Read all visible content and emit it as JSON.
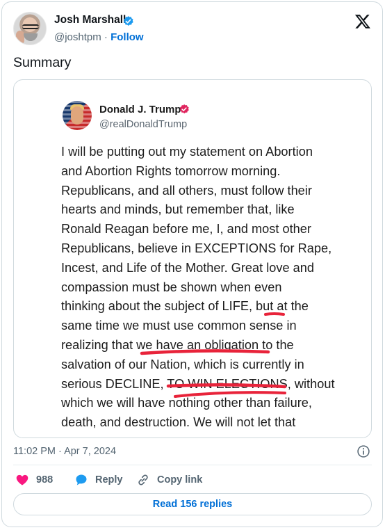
{
  "author": {
    "name": "Josh Marshall",
    "handle": "@joshtpm",
    "separator": "·",
    "follow_label": "Follow"
  },
  "tweet": {
    "text": "Summary",
    "timestamp": "11:02 PM · Apr 7, 2024"
  },
  "embedded_post": {
    "name": "Donald J. Trump",
    "handle": "@realDonaldTrump",
    "lines": [
      "I will be putting out my statement on Abortion",
      "and Abortion Rights tomorrow morning.",
      "Republicans, and all others, must follow their",
      "hearts and minds, but remember that, like",
      "Ronald Reagan before me, I, and most other",
      "Republicans, believe in EXCEPTIONS for Rape,",
      "Incest, and Life of the Mother. Great love and",
      "compassion must be shown when even",
      "thinking about the subject of LIFE, but at the",
      "same time we must use common sense in",
      "realizing that we have an obligation to the",
      "salvation of our Nation, which is currently in",
      "serious DECLINE, TO WIN ELECTIONS, without",
      "which we will have nothing other than failure,",
      "death, and destruction. We will not let that"
    ],
    "underline_color": "#e8233a"
  },
  "actions": {
    "like_count": "988",
    "reply_label": "Reply",
    "copy_label": "Copy link"
  },
  "read_replies_label": "Read 156 replies",
  "colors": {
    "accent": "#006fd6",
    "verified": "#1d9bf0",
    "like": "#f91880",
    "muted": "#536471",
    "border": "#cfd9de"
  },
  "icons": {
    "brand": "x-logo-icon",
    "verified": "verified-badge-icon",
    "trump_badge": "verified-badge-pink-icon",
    "info": "info-icon",
    "like": "heart-icon",
    "reply": "speech-bubble-icon",
    "copy": "link-icon"
  }
}
